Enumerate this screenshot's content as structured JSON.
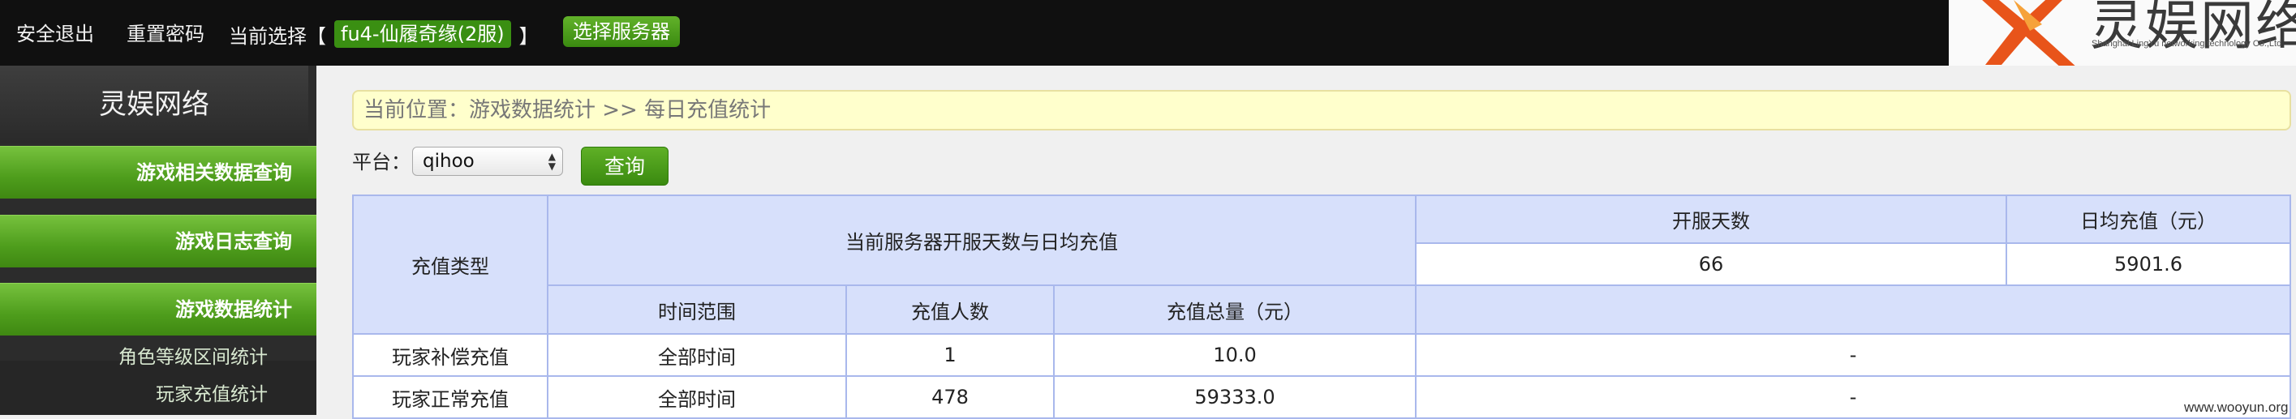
{
  "topbar": {
    "logout": "安全退出",
    "reset_password": "重置密码",
    "current_select_prefix": "当前选择【",
    "current_server": "fu4-仙履奇缘(2服)",
    "current_select_suffix": "】",
    "choose_server": "选择服务器"
  },
  "logo": {
    "text": "灵娱网络",
    "subtitle": "Shanghai LingYu networking technology Co.,Ltd"
  },
  "sidebar": {
    "brand": "灵娱网络",
    "menu": [
      {
        "label": "游戏相关数据查询"
      },
      {
        "label": "游戏日志查询"
      },
      {
        "label": "游戏数据统计"
      }
    ],
    "sub_items": [
      {
        "label": "角色等级区间统计"
      },
      {
        "label": "玩家充值统计"
      }
    ]
  },
  "breadcrumb": "当前位置：游戏数据统计 >> 每日充值统计",
  "filter": {
    "platform_label": "平台：",
    "platform_value": "qihoo",
    "query_button": "查询"
  },
  "table": {
    "recharge_type_header": "充值类型",
    "summary_header": "当前服务器开服天数与日均充值",
    "open_days_header": "开服天数",
    "daily_avg_header": "日均充值（元）",
    "open_days_value": "66",
    "daily_avg_value": "5901.6",
    "col_time_range": "时间范围",
    "col_payers": "充值人数",
    "col_total": "充值总量（元）",
    "rows": [
      {
        "type": "玩家补偿充值",
        "range": "全部时间",
        "payers": "1",
        "total": "10.0",
        "extra": "-"
      },
      {
        "type": "玩家正常充值",
        "range": "全部时间",
        "payers": "478",
        "total": "59333.0",
        "extra": "-"
      }
    ]
  },
  "watermark": "www.wooyun.org",
  "colors": {
    "accent_green": "#3a8f12",
    "table_header_bg": "#d7e0fb",
    "table_border": "#a9b8ec",
    "breadcrumb_bg": "#ffffcc"
  }
}
